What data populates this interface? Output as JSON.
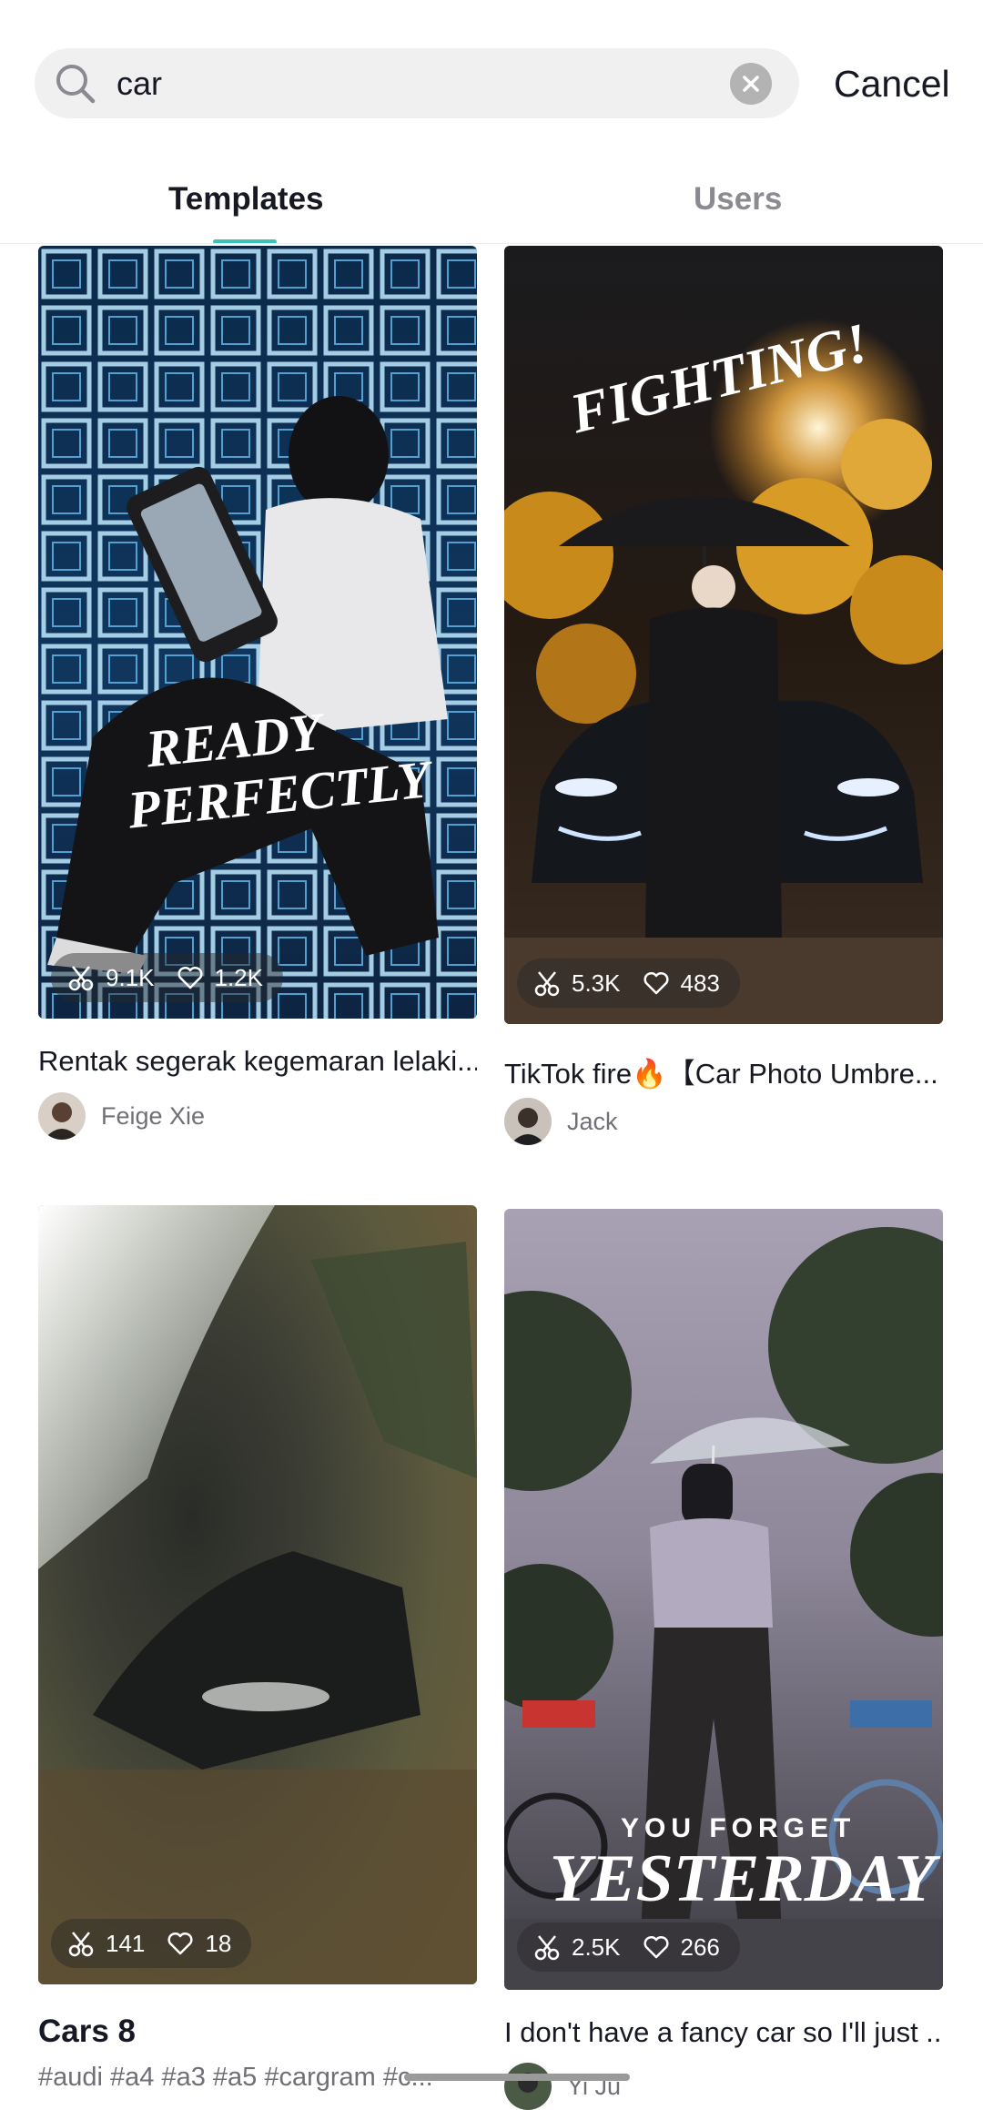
{
  "search": {
    "query": "car",
    "cancel_label": "Cancel"
  },
  "tabs": [
    {
      "label": "Templates",
      "active": true
    },
    {
      "label": "Users",
      "active": false
    }
  ],
  "accent_color": "#3ec1b6",
  "templates": [
    {
      "title": "Rentak segerak kegemaran lelaki...",
      "uses": "9.1K",
      "likes": "1.2K",
      "author": "Feige Xie",
      "overlay_text": [
        "READY",
        "PERFECTLY"
      ]
    },
    {
      "title": "TikTok fire🔥【Car Photo Umbre...",
      "uses": "5.3K",
      "likes": "483",
      "author": "Jack",
      "overlay_text": [
        "FIGHTING!"
      ]
    },
    {
      "title": "Cars 8",
      "uses": "141",
      "likes": "18",
      "tags": "#audi #a4 #a3 #a5 #cargram #c..."
    },
    {
      "title": "I don't have a fancy car so I'll just ...",
      "uses": "2.5K",
      "likes": "266",
      "author": "Yi Ju",
      "overlay_text": [
        "YOU FORGET",
        "YESTERDAY"
      ]
    }
  ],
  "icons": {
    "search": "search-icon",
    "clear": "clear-icon",
    "uses": "scissors-icon",
    "likes": "heart-icon"
  }
}
